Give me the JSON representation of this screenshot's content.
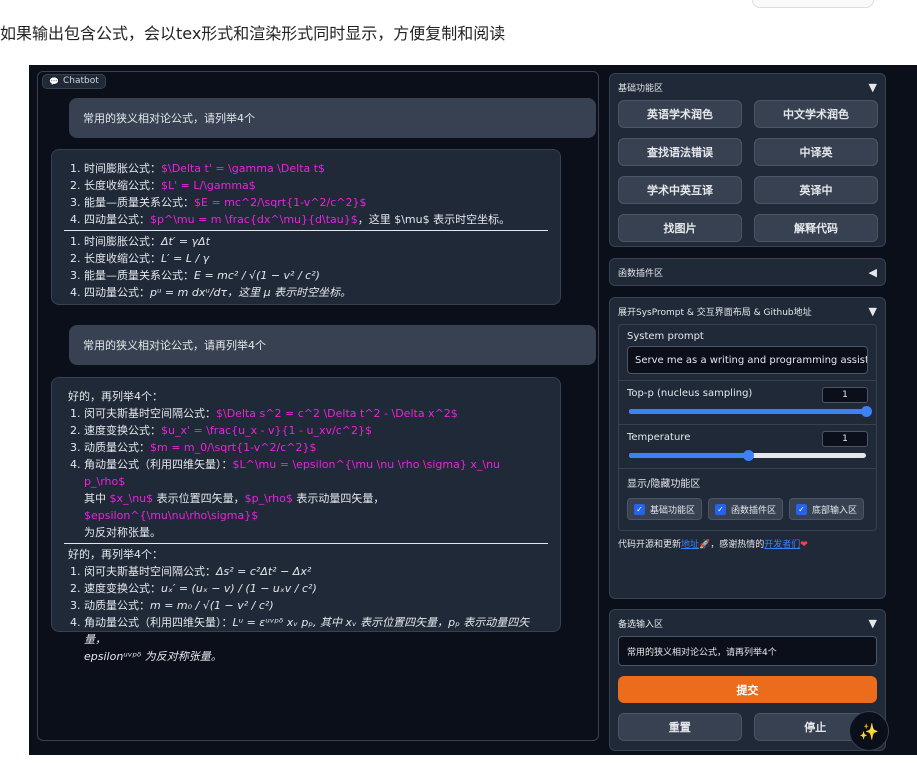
{
  "page": {
    "caption": "如果输出包含公式，会以tex形式和渲染形式同时显示，方便复制和阅读"
  },
  "chatbot": {
    "label": "Chatbot",
    "icon": "chat-bubble-icon",
    "q1": "常用的狭义相对论公式，请列举4个",
    "a1_tex": [
      {
        "name": "时间膨胀公式：",
        "tex": "$\\Delta t' = \\gamma \\Delta t$",
        "after": ""
      },
      {
        "name": "长度收缩公式：",
        "tex": "$L' = L/\\gamma$",
        "after": ""
      },
      {
        "name": "能量—质量关系公式：",
        "tex": "$E = mc^2/\\sqrt{1-v^2/c^2}$",
        "after": ""
      },
      {
        "name": "四动量公式：",
        "tex": "$p^\\mu = m \\frac{dx^\\mu}{d\\tau}$",
        "after": "，这里 $\\mu$ 表示时空坐标。"
      }
    ],
    "a1_rendered": [
      {
        "name": "时间膨胀公式：",
        "formula": "Δt′ = γΔt"
      },
      {
        "name": "长度收缩公式：",
        "formula": "L′ = L / γ"
      },
      {
        "name": "能量—质量关系公式：",
        "formula": "E = mc² / √(1 − v² / c²)"
      },
      {
        "name": "四动量公式：",
        "formula": "pᵘ = m dxᵘ/dτ，这里 μ 表示时空坐标。"
      }
    ],
    "q2": "常用的狭义相对论公式，请再列举4个",
    "a2_intro": "好的，再列举4个：",
    "a2_tex": [
      {
        "name": "闵可夫斯基时空间隔公式：",
        "tex": "$\\Delta s^2 = c^2 \\Delta t^2 - \\Delta x^2$"
      },
      {
        "name": "速度变换公式：",
        "tex": "$u_x' = \\frac{u_x - v}{1 - u_xv/c^2}$"
      },
      {
        "name": "动质量公式：",
        "tex": "$m = m_0/\\sqrt{1-v^2/c^2}$"
      },
      {
        "name": "角动量公式（利用四维矢量）：",
        "tex": "$L^\\mu = \\epsilon^{\\mu \\nu \\rho \\sigma} x_\\nu p_\\rho$"
      }
    ],
    "a2_tex_tail": {
      "p1": "其中 ",
      "x": "$x_\\nu$",
      "p2": " 表示位置四矢量，",
      "p": "$p_\\rho$",
      "p3": " 表示动量四矢量，",
      "eps": "$epsilon^{\\mu\\nu\\rho\\sigma}$",
      "p4": "为反对称张量。"
    },
    "a2_rendered_intro": "好的，再列举4个：",
    "a2_rendered": [
      {
        "name": "闵可夫斯基时空间隔公式：",
        "formula": "Δs² = c²Δt² − Δx²"
      },
      {
        "name": "速度变换公式：",
        "formula": "uₓ′ = (uₓ − v) / (1 − uₓv / c²)"
      },
      {
        "name": "动质量公式：",
        "formula": "m = m₀ / √(1 − v² / c²)"
      },
      {
        "name": "角动量公式（利用四维矢量）：",
        "formula": "Lᵘ = εᵘᵛᵖᵟ xᵥ pₚ, 其中 xᵥ 表示位置四矢量，pₚ 表示动量四矢量，"
      }
    ],
    "a2_rendered_tail": "epsilonᵘᵛᵖᵟ 为反对称张量。"
  },
  "panel_basic": {
    "title": "基础功能区",
    "arrow": "▼",
    "buttons": [
      "英语学术润色",
      "中文学术润色",
      "查找语法错误",
      "中译英",
      "学术中英互译",
      "英译中",
      "找图片",
      "解释代码"
    ]
  },
  "panel_plugin": {
    "title": "函数插件区",
    "arrow": "◀"
  },
  "panel_sys": {
    "title": "展开SysPrompt & 交互界面布局 & Github地址",
    "arrow": "▼",
    "system_prompt_label": "System prompt",
    "system_prompt_value": "Serve me as a writing and programming assistant.",
    "top_p_label": "Top-p (nucleus sampling)",
    "top_p_value": "1",
    "top_p_fraction": 1.0,
    "temperature_label": "Temperature",
    "temperature_value": "1",
    "temperature_fraction": 0.5,
    "toggle_label": "显示/隐藏功能区",
    "checks": [
      "基础功能区",
      "函数插件区",
      "底部输入区"
    ],
    "footer_pre": "代码开源和更新",
    "footer_link1": "地址",
    "footer_mid": "🚀，感谢热情的",
    "footer_link2": "开发者们",
    "footer_heart": "❤"
  },
  "panel_input": {
    "title": "备选输入区",
    "arrow": "▼",
    "value": "常用的狭义相对论公式，请再列举4个",
    "submit": "提交",
    "reset": "重置",
    "stop": "停止"
  },
  "fab": {
    "icon": "magic-wand-icon",
    "glyph": "✨"
  }
}
